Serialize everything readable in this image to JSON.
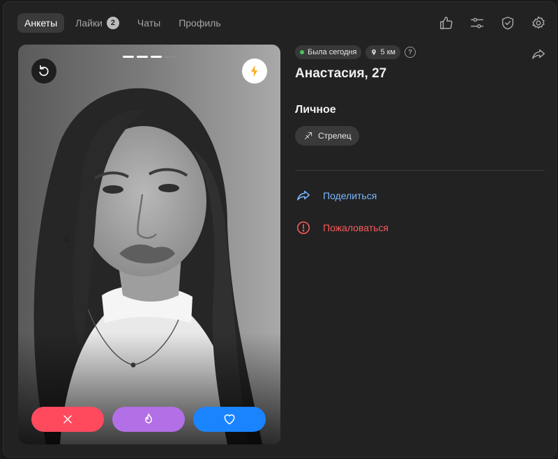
{
  "tabs": [
    {
      "label": "Анкеты",
      "active": true
    },
    {
      "label": "Лайки",
      "badge": "2"
    },
    {
      "label": "Чаты"
    },
    {
      "label": "Профиль"
    }
  ],
  "header_icons": [
    "thumbs-up-icon",
    "sliders-icon",
    "shield-check-icon",
    "gear-icon"
  ],
  "card": {
    "photo_count": 4,
    "current_photo": 3,
    "buttons": [
      "undo",
      "boost",
      "dislike",
      "super-like",
      "like"
    ]
  },
  "profile": {
    "status": "Была сегодня",
    "distance": "5 км",
    "name": "Анастасия, 27",
    "section_title": "Личное",
    "zodiac": "Стрелец"
  },
  "links": {
    "share": "Поделиться",
    "report": "Пожаловаться"
  },
  "colors": {
    "online": "#49c463",
    "dislike": "#ff4a5e",
    "super": "#b36fe6",
    "like": "#1a84ff",
    "boost": "#ffaa1a",
    "share_link": "#7cb6ff",
    "report_link": "#ff5a5a"
  }
}
